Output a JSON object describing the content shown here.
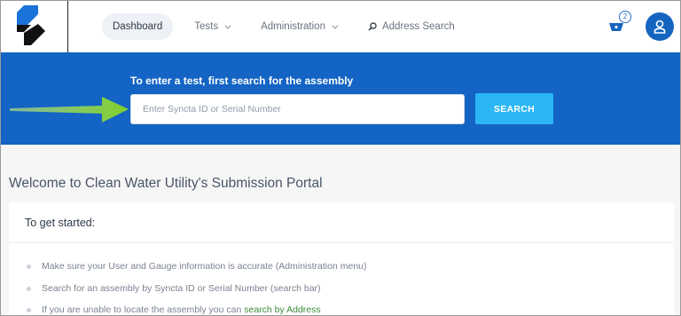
{
  "nav": {
    "items": [
      {
        "label": "Dashboard",
        "active": true,
        "dropdown": false
      },
      {
        "label": "Tests",
        "active": false,
        "dropdown": true
      },
      {
        "label": "Administration",
        "active": false,
        "dropdown": true
      }
    ],
    "address_search": "Address Search"
  },
  "cart": {
    "count": "2",
    "icon": "cart-icon"
  },
  "user": {
    "icon": "user-icon"
  },
  "banner": {
    "title": "To enter a test, first search for the assembly",
    "placeholder": "Enter Syncta ID or Serial Number",
    "search_label": "SEARCH"
  },
  "main": {
    "welcome": "Welcome to Clean Water Utility's Submission Portal",
    "card_title": "To get started:",
    "steps": [
      "Make sure your User and Gauge information is accurate (Administration menu)",
      "Search for an assembly by Syncta ID or Serial Number (search bar)"
    ],
    "step3_prefix": "If you are unable to locate the assembly you can ",
    "step3_link": "search by Address"
  },
  "colors": {
    "banner": "#1364c4",
    "search_button": "#2bb6f5",
    "arrow": "#8cd53a",
    "link": "#3c8c3c"
  }
}
